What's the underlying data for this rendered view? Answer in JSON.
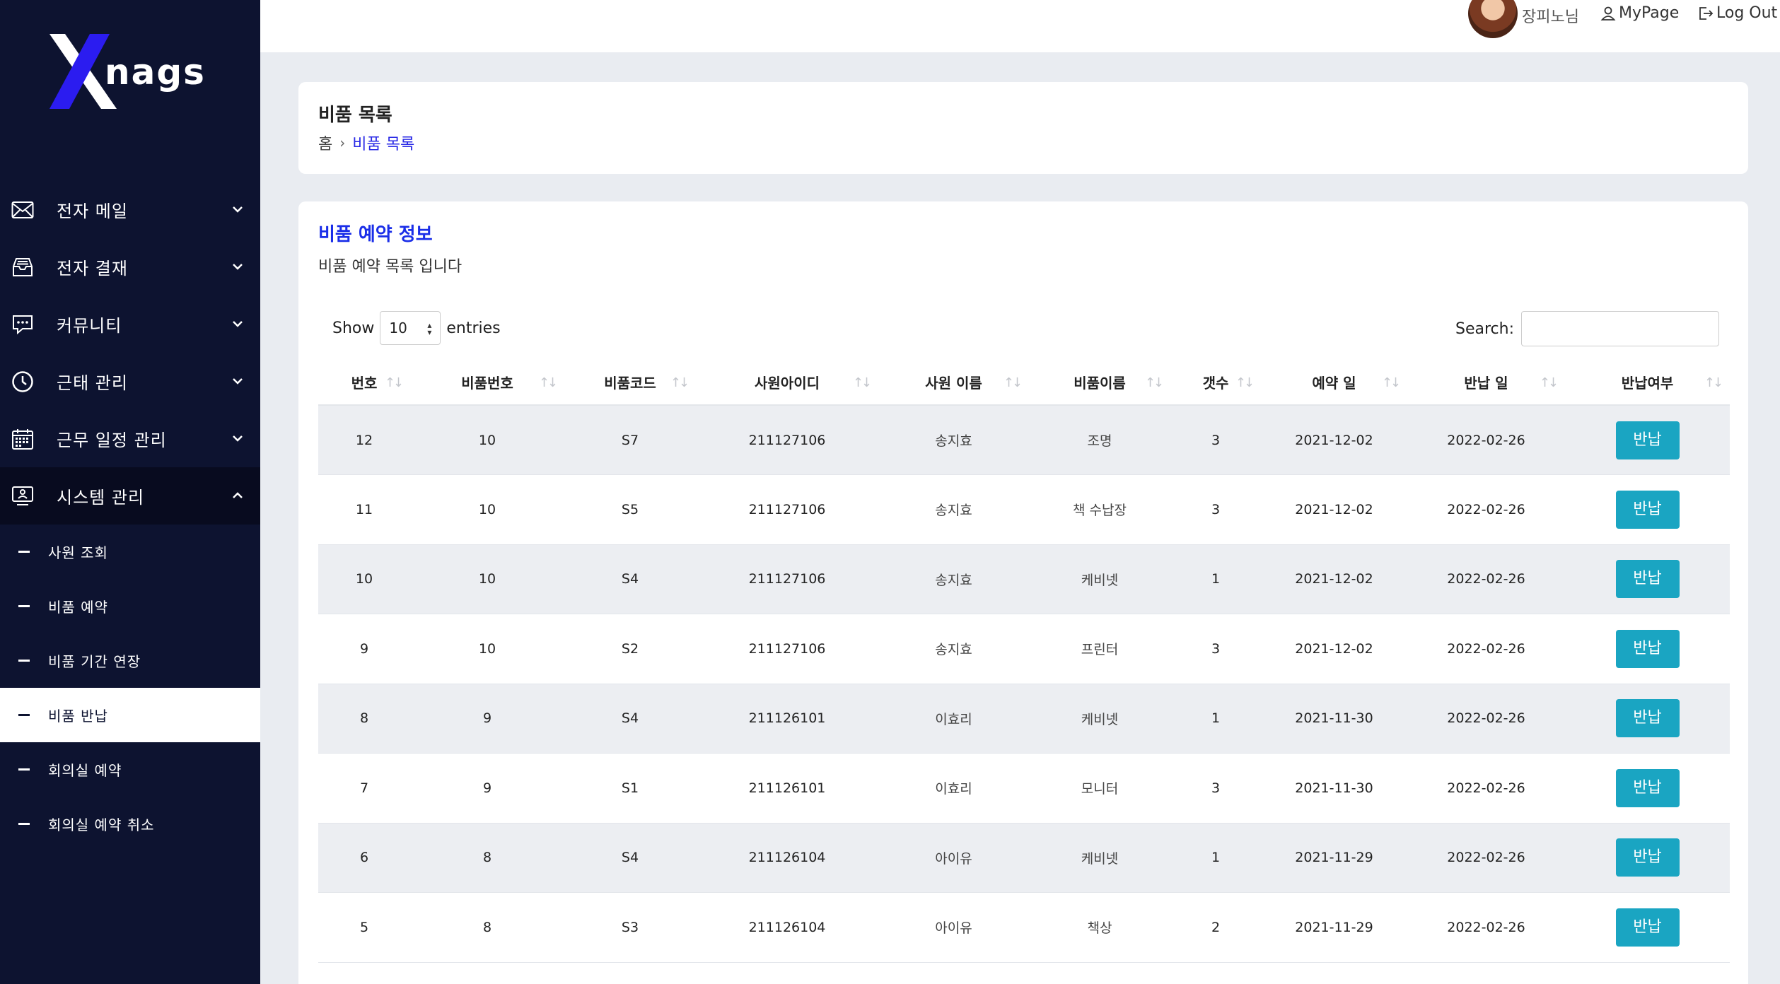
{
  "brand": {
    "logo_text": "nags",
    "logo_letter": "X"
  },
  "topbar": {
    "user_name": "장피노님",
    "mypage_label": "MyPage",
    "logout_label": "Log Out"
  },
  "sidebar": {
    "items": [
      {
        "label": "전자 메일",
        "icon": "mail-icon"
      },
      {
        "label": "전자 결재",
        "icon": "inbox-icon"
      },
      {
        "label": "커뮤니티",
        "icon": "chat-icon"
      },
      {
        "label": "근태 관리",
        "icon": "clock-icon"
      },
      {
        "label": "근무 일정 관리",
        "icon": "calendar-icon"
      },
      {
        "label": "시스템 관리",
        "icon": "monitor-user-icon"
      }
    ],
    "sub_items": [
      {
        "label": "사원 조회"
      },
      {
        "label": "비품 예약"
      },
      {
        "label": "비품 기간 연장"
      },
      {
        "label": "비품 반납"
      },
      {
        "label": "회의실 예약"
      },
      {
        "label": "회의실 예약 취소"
      }
    ]
  },
  "page_header": {
    "title": "비품 목록",
    "breadcrumb_home": "홈",
    "breadcrumb_current": "비품 목록"
  },
  "main": {
    "title": "비품 예약 정보",
    "subtitle": "비품 예약 목록 입니다",
    "show_label": "Show",
    "entries_value": "10",
    "entries_label": "entries",
    "search_label": "Search:",
    "search_value": ""
  },
  "table": {
    "columns": [
      "번호",
      "비품번호",
      "비품코드",
      "사원아이디",
      "사원 이름",
      "비품이름",
      "갯수",
      "예약 일",
      "반납 일",
      "반납여부"
    ],
    "rows": [
      {
        "no": "12",
        "item_no": "10",
        "code": "S7",
        "emp_id": "211127106",
        "emp_name": "송지효",
        "item_name": "조명",
        "count": "3",
        "reserve": "2021-12-02",
        "return": "2022-02-26",
        "action": "반납"
      },
      {
        "no": "11",
        "item_no": "10",
        "code": "S5",
        "emp_id": "211127106",
        "emp_name": "송지효",
        "item_name": "책 수납장",
        "count": "3",
        "reserve": "2021-12-02",
        "return": "2022-02-26",
        "action": "반납"
      },
      {
        "no": "10",
        "item_no": "10",
        "code": "S4",
        "emp_id": "211127106",
        "emp_name": "송지효",
        "item_name": "케비넷",
        "count": "1",
        "reserve": "2021-12-02",
        "return": "2022-02-26",
        "action": "반납"
      },
      {
        "no": "9",
        "item_no": "10",
        "code": "S2",
        "emp_id": "211127106",
        "emp_name": "송지효",
        "item_name": "프린터",
        "count": "3",
        "reserve": "2021-12-02",
        "return": "2022-02-26",
        "action": "반납"
      },
      {
        "no": "8",
        "item_no": "9",
        "code": "S4",
        "emp_id": "211126101",
        "emp_name": "이효리",
        "item_name": "케비넷",
        "count": "1",
        "reserve": "2021-11-30",
        "return": "2022-02-26",
        "action": "반납"
      },
      {
        "no": "7",
        "item_no": "9",
        "code": "S1",
        "emp_id": "211126101",
        "emp_name": "이효리",
        "item_name": "모니터",
        "count": "3",
        "reserve": "2021-11-30",
        "return": "2022-02-26",
        "action": "반납"
      },
      {
        "no": "6",
        "item_no": "8",
        "code": "S4",
        "emp_id": "211126104",
        "emp_name": "아이유",
        "item_name": "케비넷",
        "count": "1",
        "reserve": "2021-11-29",
        "return": "2022-02-26",
        "action": "반납"
      },
      {
        "no": "5",
        "item_no": "8",
        "code": "S3",
        "emp_id": "211126104",
        "emp_name": "아이유",
        "item_name": "책상",
        "count": "2",
        "reserve": "2021-11-29",
        "return": "2022-02-26",
        "action": "반납"
      }
    ]
  },
  "colors": {
    "sidebar_bg": "#0d1330",
    "accent_blue": "#1a2ee8",
    "return_button": "#1aa5c2",
    "logo_x": "#2b1cf0"
  }
}
